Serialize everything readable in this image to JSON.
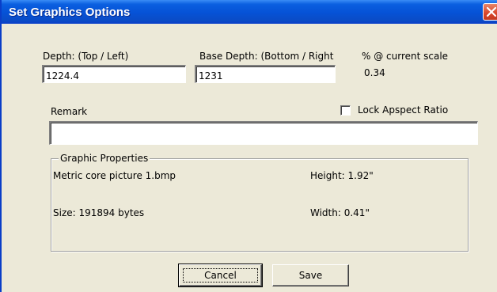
{
  "window": {
    "title": "Set Graphics Options",
    "close_icon": "close-x-icon"
  },
  "depth": {
    "label": "Depth: (Top / Left)",
    "value": "1224.4"
  },
  "base_depth": {
    "label": "Base Depth: (Bottom / Right",
    "value": "1231"
  },
  "scale": {
    "label": "% @ current scale",
    "value": "0.34"
  },
  "remark": {
    "label": "Remark",
    "value": ""
  },
  "lock_aspect": {
    "label": "Lock Apspect Ratio",
    "checked": false
  },
  "graphic_properties": {
    "legend": "Graphic Properties",
    "file_name": "Metric core picture 1.bmp",
    "size": "Size: 191894 bytes",
    "height": "Height: 1.92\"",
    "width": "Width: 0.41\""
  },
  "buttons": {
    "cancel": "Cancel",
    "save": "Save"
  },
  "colors": {
    "titlebar": "#0a5fe0",
    "dialog_bg": "#ece9d8",
    "close_button": "#d8452a"
  }
}
